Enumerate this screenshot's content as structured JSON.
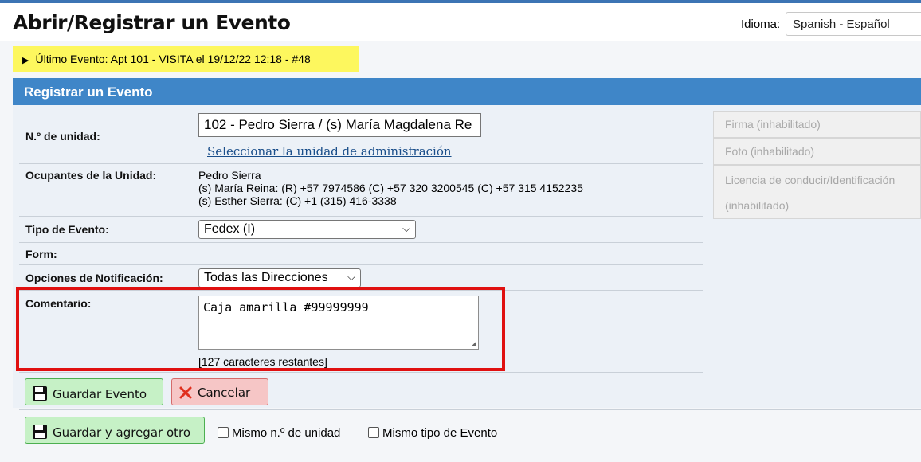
{
  "header": {
    "title": "Abrir/Registrar un Evento",
    "language_label": "Idioma:",
    "language_value": "Spanish - Español"
  },
  "last_event": "Último Evento: Apt 101 - VISITA el 19/12/22 12:18 - #48",
  "panel": {
    "title": "Registrar un Evento"
  },
  "form": {
    "unit_label": "N.º de unidad:",
    "unit_value": "102 - Pedro Sierra / (s) María Magdalena Re",
    "unit_link": "Seleccionar la unidad de administración",
    "occupants_label": "Ocupantes de la Unidad:",
    "occupants": [
      "Pedro Sierra",
      "(s) María Reina: (R) +57 7974586 (C) +57 320 3200545 (C) +57 315 4152235",
      "(s) Esther Sierra: (C) +1 (315) 416-3338"
    ],
    "event_type_label": "Tipo de Evento:",
    "event_type_value": "Fedex (I)",
    "form_label": "Form:",
    "notify_label": "Opciones de Notificación:",
    "notify_value": "Todas las Direcciones",
    "comment_label": "Comentario:",
    "comment_value": "Caja amarilla #99999999",
    "remaining": "[127 caracteres restantes]"
  },
  "side_buttons": {
    "signature": "Firma (inhabilitado)",
    "photo": "Foto (inhabilitado)",
    "license_line1": "Licencia de conducir/Identificación",
    "license_line2": "(inhabilitado)"
  },
  "actions": {
    "save": "Guardar Evento",
    "cancel": "Cancelar",
    "save_add": "Guardar y agregar otro",
    "same_unit": "Mismo n.º de unidad",
    "same_type": "Mismo tipo de Evento"
  },
  "colors": {
    "accent": "#3f86c8",
    "highlight": "#fdf75e",
    "annotation": "#e01010",
    "save_button": "#c6f1c6",
    "cancel_button": "#f6c6c6"
  }
}
